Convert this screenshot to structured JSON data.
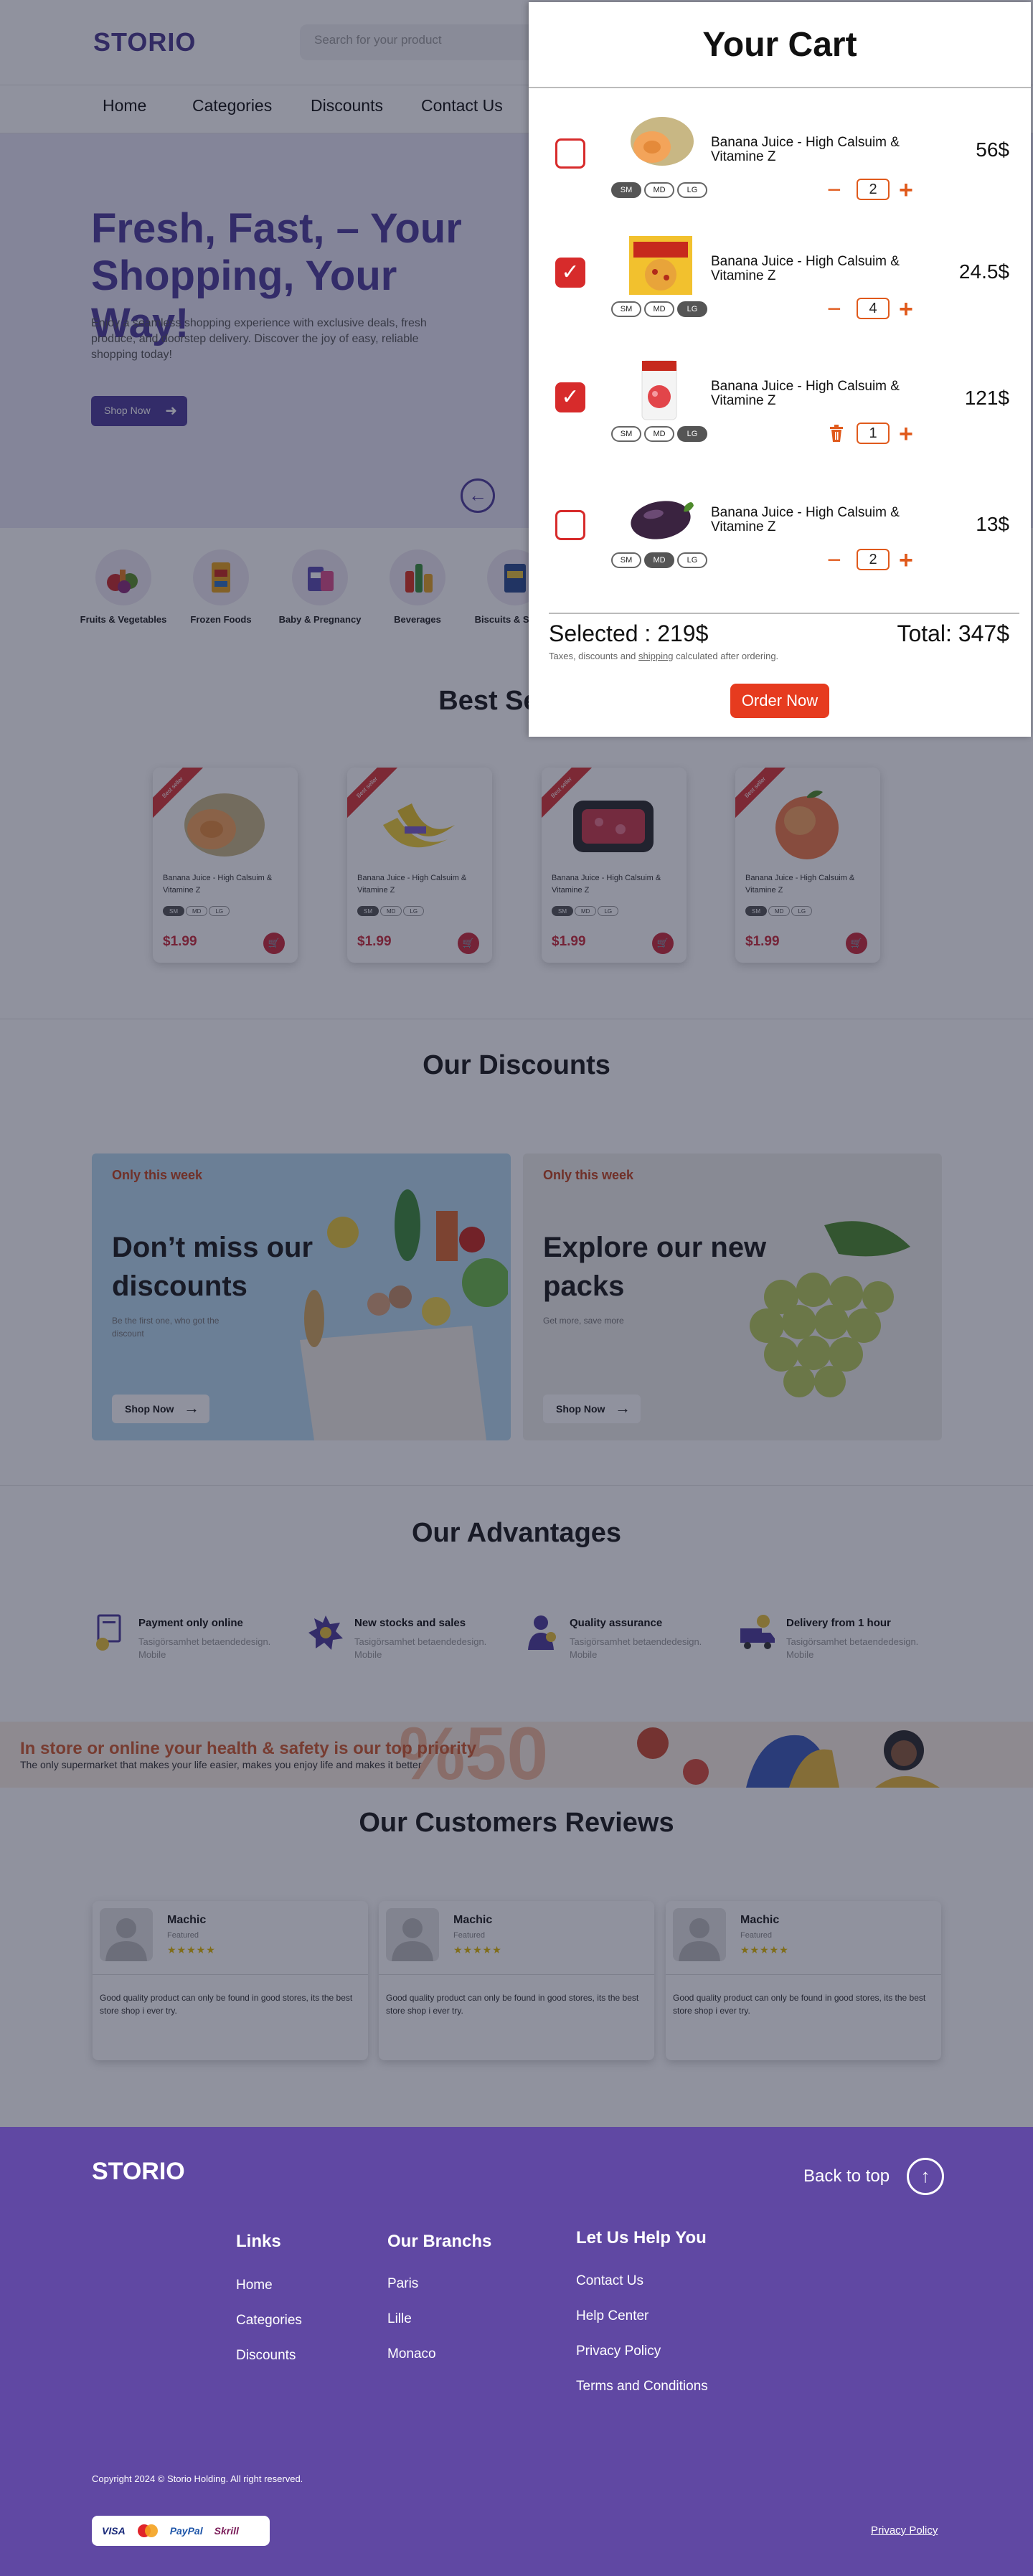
{
  "header": {
    "logo": "STORIO",
    "search_placeholder": "Search for your product"
  },
  "nav": [
    "Home",
    "Categories",
    "Discounts",
    "Contact Us"
  ],
  "hero": {
    "title": "Fresh, Fast, – Your Shopping, Your Way!",
    "text": "Enjoy a seamless shopping experience with exclusive deals, fresh produce, and doorstep delivery. Discover the joy of easy, reliable shopping today!",
    "button": "Shop Now"
  },
  "categories": [
    "Fruits & Vegetables",
    "Frozen Foods",
    "Baby & Pregnancy",
    "Beverages",
    "Biscuits & Snacks"
  ],
  "best_selling": {
    "title": "Best Selling",
    "products": [
      {
        "name": "Banana Juice - High Calsuim & Vitamine Z",
        "price": "$1.99",
        "ribbon": "Best seller"
      },
      {
        "name": "Banana Juice - High Calsuim & Vitamine Z",
        "price": "$1.99",
        "ribbon": "Best seller"
      },
      {
        "name": "Banana Juice - High Calsuim & Vitamine Z",
        "price": "$1.99",
        "ribbon": "Best seller"
      },
      {
        "name": "Banana Juice - High Calsuim & Vitamine Z",
        "price": "$1.99",
        "ribbon": "Best seller"
      }
    ],
    "sizes": [
      "SM",
      "MD",
      "LG"
    ]
  },
  "discounts": {
    "title": "Our Discounts",
    "cards": [
      {
        "tag": "Only this week",
        "title": "Don’t miss our discounts",
        "sub": "Be the first one, who got the discount",
        "button": "Shop Now"
      },
      {
        "tag": "Only this week",
        "title": "Explore our new packs",
        "sub": "Get more, save more",
        "button": "Shop Now"
      }
    ]
  },
  "advantages": {
    "title": "Our Advantages",
    "items": [
      {
        "title": "Payment only online",
        "sub": "Tasigörsamhet betaendedesign. Mobile"
      },
      {
        "title": "New stocks and sales",
        "sub": "Tasigörsamhet betaendedesign. Mobile"
      },
      {
        "title": "Quality assurance",
        "sub": "Tasigörsamhet betaendedesign. Mobile"
      },
      {
        "title": "Delivery from 1 hour",
        "sub": "Tasigörsamhet betaendedesign. Mobile"
      }
    ]
  },
  "promo": {
    "title": "In store or online your health & safety is our top priority",
    "sub": "The only supermarket that makes your life easier, makes you enjoy life and makes it better",
    "big": "%50"
  },
  "reviews": {
    "title": "Our Customers Reviews",
    "items": [
      {
        "name": "Machic",
        "role": "Featured",
        "stars": "★★★★★",
        "text": "Good quality product can only be found in good stores, its the best store shop i ever try."
      },
      {
        "name": "Machic",
        "role": "Featured",
        "stars": "★★★★★",
        "text": "Good quality product can only be found in good stores, its the best store shop i ever try."
      },
      {
        "name": "Machic",
        "role": "Featured",
        "stars": "★★★★★",
        "text": "Good quality product can only be found in good stores, its the best store shop i ever try."
      }
    ]
  },
  "footer": {
    "logo": "STORIO",
    "back_to_top": "Back to top",
    "links_title": "Links",
    "links": [
      "Home",
      "Categories",
      "Discounts"
    ],
    "branches_title": "Our Branchs",
    "branches": [
      "Paris",
      "Lille",
      "Monaco"
    ],
    "help_title": "Let Us Help You",
    "help": [
      "Contact Us",
      "Help Center",
      "Privacy Policy",
      "Terms and Conditions"
    ],
    "copyright": "Copyright 2024 © Storio Holding. All right reserved.",
    "payments": [
      "VISA",
      "PayPal",
      "Skrill"
    ],
    "privacy": "Privacy Policy"
  },
  "cart": {
    "title": "Your Cart",
    "items": [
      {
        "name": "Banana Juice - High Calsuim & Vitamine Z",
        "qty": "2",
        "total": "56$",
        "checked": false,
        "size": "SM",
        "image": "melon"
      },
      {
        "name": "Banana Juice - High Calsuim & Vitamine Z",
        "qty": "4",
        "total": "24.5$",
        "checked": true,
        "size": "LG",
        "image": "pizza"
      },
      {
        "name": "Banana Juice - High Calsuim & Vitamine Z",
        "qty": "1",
        "total": "121$",
        "checked": true,
        "size": "LG",
        "image": "can"
      },
      {
        "name": "Banana Juice - High Calsuim & Vitamine Z",
        "qty": "2",
        "total": "13$",
        "checked": false,
        "size": "MD",
        "image": "eggplant"
      }
    ],
    "sizes": [
      "SM",
      "MD",
      "LG"
    ],
    "selected": "Selected : 219$",
    "total": "Total: 347$",
    "note_before": "Taxes, discounts and ",
    "note_link": "shipping",
    "note_after": " calculated after ordering.",
    "order_button": "Order Now"
  },
  "colors": {
    "brand": "#4e3c99",
    "footer": "#6048a3",
    "accent": "#e05a1c",
    "check": "#d72b2b",
    "price": "#c92b3b"
  }
}
